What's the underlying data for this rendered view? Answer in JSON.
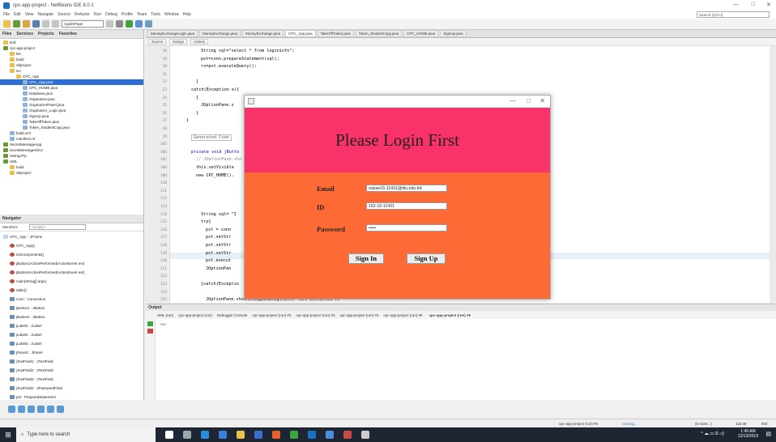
{
  "window": {
    "title": "cpc-app-project - NetBeans IDE 8.0.1",
    "minimize": "—",
    "maximize": "□",
    "close": "✕"
  },
  "menu": [
    "File",
    "Edit",
    "View",
    "Navigate",
    "Source",
    "Refactor",
    "Run",
    "Debug",
    "Profile",
    "Team",
    "Tools",
    "Window",
    "Help"
  ],
  "search": {
    "placeholder": "Search (Ctrl+I)"
  },
  "toolbar": {
    "config": "AppletPage"
  },
  "projects_panel": {
    "tabs": [
      "Files",
      "Services",
      "Projects",
      "Favorites"
    ],
    "tree": [
      {
        "label": "Eoll",
        "indent": 0,
        "icon": "folder"
      },
      {
        "label": "cpc-app-project",
        "indent": 0,
        "icon": "proj"
      },
      {
        "label": "bin",
        "indent": 1,
        "icon": "folder"
      },
      {
        "label": "build",
        "indent": 1,
        "icon": "folder"
      },
      {
        "label": "nbproject",
        "indent": 1,
        "icon": "folder"
      },
      {
        "label": "src",
        "indent": 1,
        "icon": "folder"
      },
      {
        "label": "CPC_App",
        "indent": 2,
        "icon": "folder"
      },
      {
        "label": "CPC_App.java",
        "indent": 3,
        "icon": "file",
        "selected": true
      },
      {
        "label": "CPC_HOME.java",
        "indent": 3,
        "icon": "file"
      },
      {
        "label": "Database.java",
        "indent": 3,
        "icon": "file"
      },
      {
        "label": "Organaizer.java",
        "indent": 3,
        "icon": "file"
      },
      {
        "label": "OrganaizerPanel.java",
        "indent": 3,
        "icon": "file"
      },
      {
        "label": "Organaizer_Login.java",
        "indent": 3,
        "icon": "file"
      },
      {
        "label": "SignUp.java",
        "indent": 3,
        "icon": "file"
      },
      {
        "label": "TakeOffToken.java",
        "indent": 3,
        "icon": "file"
      },
      {
        "label": "Token_StudentCopy.java",
        "indent": 3,
        "icon": "file"
      },
      {
        "label": "build.xml",
        "indent": 1,
        "icon": "file"
      },
      {
        "label": "manifest.mf",
        "indent": 1,
        "icon": "file"
      },
      {
        "label": "SecretMessageApp",
        "indent": 0,
        "icon": "proj"
      },
      {
        "label": "secretMessagesGUI",
        "indent": 0,
        "icon": "proj"
      },
      {
        "label": "SwingAPp",
        "indent": 0,
        "icon": "proj"
      },
      {
        "label": "UML",
        "indent": 0,
        "icon": "proj"
      },
      {
        "label": "build",
        "indent": 1,
        "icon": "folder"
      },
      {
        "label": "nbproject",
        "indent": 1,
        "icon": "folder"
      }
    ]
  },
  "navigator": {
    "title": "Navigator",
    "members_label": "Members",
    "members_filter": "<empty>",
    "items": [
      {
        "label": "CPC_App :: JFrame",
        "indent": 0,
        "icon": "cls"
      },
      {
        "label": "CPC_App()",
        "indent": 1,
        "icon": "meth"
      },
      {
        "label": "initComponents()",
        "indent": 1,
        "icon": "meth"
      },
      {
        "label": "jButton1ActionPerformed(ActionEvent evt)",
        "indent": 1,
        "icon": "meth"
      },
      {
        "label": "jButton2ActionPerformed(ActionEvent evt)",
        "indent": 1,
        "icon": "meth"
      },
      {
        "label": "main(String[] args)",
        "indent": 1,
        "icon": "meth"
      },
      {
        "label": "table()",
        "indent": 1,
        "icon": "meth"
      },
      {
        "label": "conn : Connection",
        "indent": 1,
        "icon": "fld"
      },
      {
        "label": "jButton1 : JButton",
        "indent": 1,
        "icon": "fld"
      },
      {
        "label": "jButton2 : JButton",
        "indent": 1,
        "icon": "fld"
      },
      {
        "label": "jLabel2 : JLabel",
        "indent": 1,
        "icon": "fld"
      },
      {
        "label": "jLabel2 : JLabel",
        "indent": 1,
        "icon": "fld"
      },
      {
        "label": "jLabel3 : JLabel",
        "indent": 1,
        "icon": "fld"
      },
      {
        "label": "jPanel1 : JPanel",
        "indent": 1,
        "icon": "fld"
      },
      {
        "label": "jTextField1 : JTextField",
        "indent": 1,
        "icon": "fld"
      },
      {
        "label": "jTextField2 : JTextField",
        "indent": 1,
        "icon": "fld"
      },
      {
        "label": "jTextField3 : JTextField",
        "indent": 1,
        "icon": "fld"
      },
      {
        "label": "jTextField4 : JPasswordField",
        "indent": 1,
        "icon": "fld"
      },
      {
        "label": "pst : PreparedStatement",
        "indent": 1,
        "icon": "fld"
      },
      {
        "label": "rs : ResultSet",
        "indent": 1,
        "icon": "fld"
      }
    ]
  },
  "editor_tabs": [
    {
      "label": "MoneyExchangeLogin.java",
      "active": false
    },
    {
      "label": "MoneyExchange.java",
      "active": false
    },
    {
      "label": "MoneyExchange.java",
      "active": false
    },
    {
      "label": "CPC_App.java",
      "active": true
    },
    {
      "label": "TakeOffToken.java",
      "active": false
    },
    {
      "label": "Token_StudentCopy.java",
      "active": false
    },
    {
      "label": "CPC_HOME.java",
      "active": false
    },
    {
      "label": "SignUp.java",
      "active": false
    }
  ],
  "editor_bar": {
    "source": "Source",
    "design": "Design",
    "history": "History"
  },
  "code_lines": [
    {
      "n": "18",
      "text": "String sql=\"select * from logininfo\";"
    },
    {
      "n": "19",
      "text": "pst=conn.prepareStatement(sql);"
    },
    {
      "n": "20",
      "text": "rs=pst.executeQuery();"
    },
    {
      "n": "21",
      "text": ""
    },
    {
      "n": "22",
      "text": "}"
    },
    {
      "n": "23",
      "text": "catch(Exception e){"
    },
    {
      "n": "24",
      "text": "{"
    },
    {
      "n": "25",
      "text": "JOptionPane.s"
    },
    {
      "n": "26",
      "text": "}"
    },
    {
      "n": "27",
      "text": "}"
    },
    {
      "n": "28",
      "text": ""
    },
    {
      "n": "29",
      "text": "Generated Code"
    },
    {
      "n": "105",
      "text": ""
    },
    {
      "n": "106",
      "text": "private void jButto"
    },
    {
      "n": "107",
      "text": "// JOptionPane.sho"
    },
    {
      "n": "108",
      "text": "this.setVisible"
    },
    {
      "n": "109",
      "text": "new CPC_HOME()."
    },
    {
      "n": "110",
      "text": ""
    },
    {
      "n": "111",
      "text": ""
    },
    {
      "n": "112",
      "text": ""
    },
    {
      "n": "113",
      "text": ""
    },
    {
      "n": "114",
      "text": "String sql= \"I"
    },
    {
      "n": "115",
      "text": "try{"
    },
    {
      "n": "116",
      "text": "pst = conn"
    },
    {
      "n": "117",
      "text": "pst.setStr"
    },
    {
      "n": "118",
      "text": "pst.setStr"
    },
    {
      "n": "119",
      "text": "pst.setStr"
    },
    {
      "n": "120",
      "text": "pst.execut"
    },
    {
      "n": "121",
      "text": "JOptionPan"
    },
    {
      "n": "122",
      "text": ""
    },
    {
      "n": "123",
      "text": "}catch(Exceptio"
    },
    {
      "n": "124",
      "text": ""
    },
    {
      "n": "125",
      "text": "JOptionPane.showMessageDialog(null, \"Not Connected\");"
    }
  ],
  "output": {
    "title": "Output",
    "tabs": [
      {
        "label": "UML (run)",
        "active": false
      },
      {
        "label": "cpc-app-project (run)",
        "active": false
      },
      {
        "label": "Debugger Console",
        "active": false
      },
      {
        "label": "cpc-app-project (run) #2",
        "active": false
      },
      {
        "label": "cpc-app-project (run) #3",
        "active": false
      },
      {
        "label": "cpc-app-project (run) #4",
        "active": false
      },
      {
        "label": "cpc-app-project (run) #5",
        "active": false
      },
      {
        "label": "cpc-app-project (run) #6",
        "active": true
      }
    ],
    "body": "run:"
  },
  "status": {
    "task": "cpc-app-project (run) #6",
    "state": "running...",
    "more": "(6 more...)",
    "position": "115:48",
    "mode": "INS"
  },
  "taskbar": {
    "search_placeholder": "Type here to search",
    "time": "1:49 AM",
    "date": "12/13/2019"
  },
  "dialog": {
    "heading": "Please Login First",
    "email_label": "Email",
    "email_value": "rejoan15-11431@diu.edu.bd",
    "id_label": "ID",
    "id_value": "162-15-11431",
    "password_label": "Password",
    "password_value": "•••••",
    "signin_label": "Sign In",
    "signup_label": "Sign Up",
    "colors": {
      "header": "#fa326a",
      "body": "#fd6a35"
    }
  }
}
